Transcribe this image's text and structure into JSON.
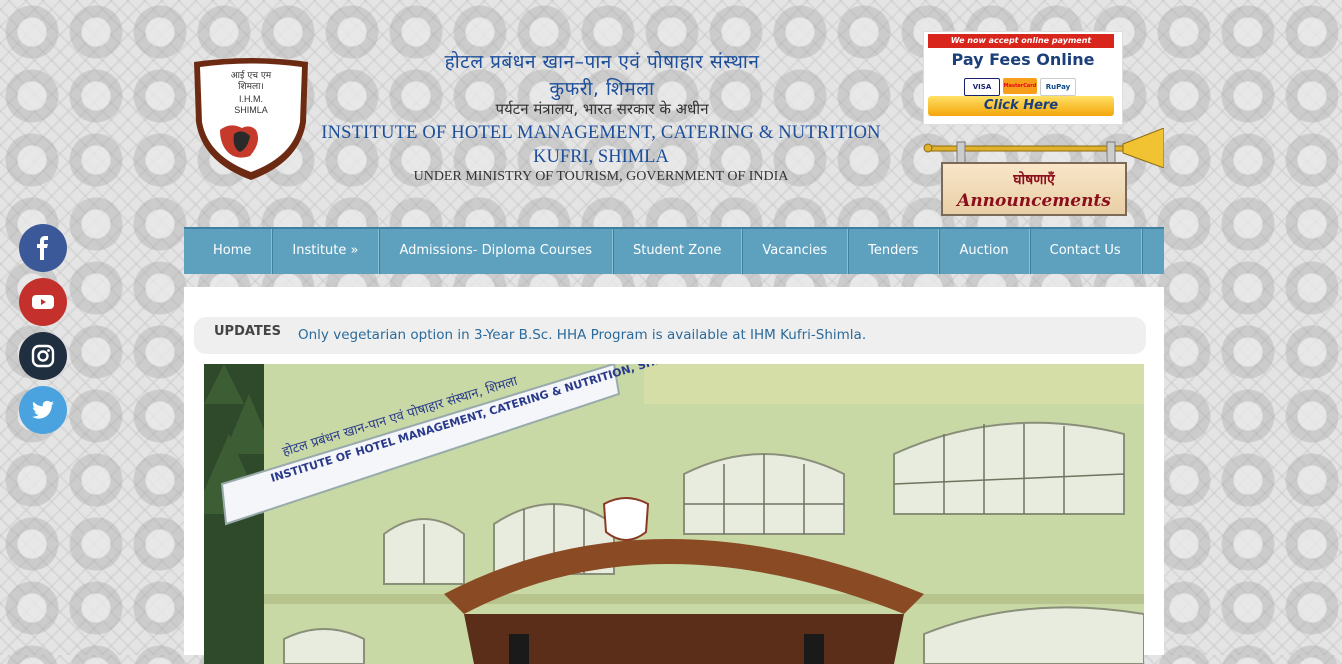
{
  "header": {
    "logo_text_hindi_1": "आई एच एम",
    "logo_text_hindi_2": "शिमला।",
    "logo_text_1": "I.H.M.",
    "logo_text_2": "SHIMLA",
    "hindi_line_1": "होटल प्रबंधन खान–पान एवं पोषाहार संस्थान",
    "hindi_line_2": "कुफरी, शिमला",
    "hindi_line_3": "पर्यटन मंत्रालय, भारत सरकार के अधीन",
    "english_line_1": "INSTITUTE OF HOTEL MANAGEMENT, CATERING & NUTRITION",
    "english_line_2": "KUFRI, SHIMLA",
    "english_line_3": "UNDER MINISTRY OF TOURISM, GOVERNMENT OF INDIA"
  },
  "pay_fees": {
    "notice": "We now accept online payment",
    "title": "Pay Fees Online",
    "card_1": "VISA",
    "card_2": "MasterCard",
    "card_3": "RuPay",
    "button": "Click Here"
  },
  "announcements": {
    "hindi": "घोषणाएँ",
    "english": "Announcements"
  },
  "nav": {
    "items": [
      {
        "label": "Home"
      },
      {
        "label": "Institute »"
      },
      {
        "label": "Admissions- Diploma Courses"
      },
      {
        "label": "Student Zone"
      },
      {
        "label": "Vacancies"
      },
      {
        "label": "Tenders"
      },
      {
        "label": "Auction"
      },
      {
        "label": "Contact Us"
      }
    ]
  },
  "updates": {
    "label": "UPDATES",
    "text": "Only vegetarian option in 3-Year B.Sc. HHA Program is available at IHM Kufri-Shimla."
  },
  "photo": {
    "signboard_hindi": "होटल प्रबंधन खान-पान एवं पोषाहार संस्थान, शिमला",
    "signboard_english": "INSTITUTE OF HOTEL MANAGEMENT, CATERING & NUTRITION, SHIMLA"
  },
  "social": {
    "facebook_color": "#3b5998",
    "youtube_color": "#c4302b",
    "instagram_color": "#1f2f3f",
    "twitter_color": "#4aa3df"
  },
  "colors": {
    "nav": "#5ea1bf",
    "header_blue": "#1b4e9b"
  }
}
